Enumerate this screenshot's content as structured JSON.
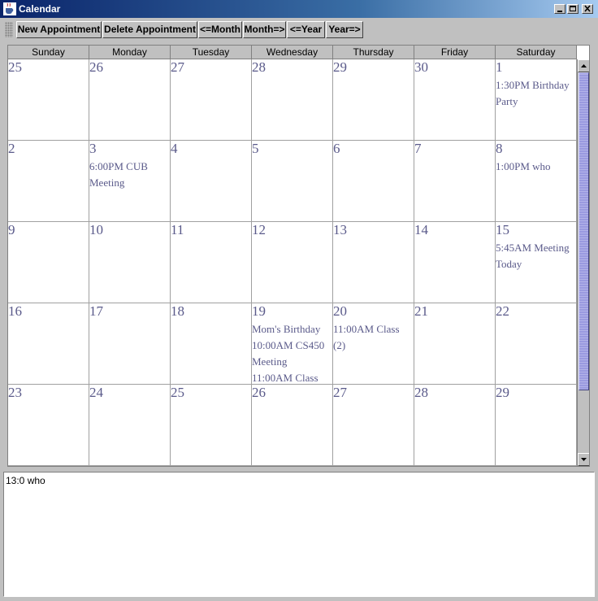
{
  "window": {
    "title": "Calendar",
    "icon": "java-coffee-icon"
  },
  "toolbar": {
    "new": "New Appointment",
    "delete": "Delete Appointment",
    "prev_month": "<=Month",
    "next_month": "Month=>",
    "prev_year": "<=Year",
    "next_year": "Year=>"
  },
  "calendar": {
    "days": [
      "Sunday",
      "Monday",
      "Tuesday",
      "Wednesday",
      "Thursday",
      "Friday",
      "Saturday"
    ],
    "weeks": [
      [
        {
          "n": "25",
          "a": []
        },
        {
          "n": "26",
          "a": []
        },
        {
          "n": "27",
          "a": []
        },
        {
          "n": "28",
          "a": []
        },
        {
          "n": "29",
          "a": []
        },
        {
          "n": "30",
          "a": []
        },
        {
          "n": "1",
          "a": [
            "1:30PM Birthday Party"
          ]
        }
      ],
      [
        {
          "n": "2",
          "a": []
        },
        {
          "n": "3",
          "a": [
            "6:00PM CUB Meeting"
          ]
        },
        {
          "n": "4",
          "a": []
        },
        {
          "n": "5",
          "a": []
        },
        {
          "n": "6",
          "a": []
        },
        {
          "n": "7",
          "a": []
        },
        {
          "n": "8",
          "a": [
            "1:00PM who"
          ]
        }
      ],
      [
        {
          "n": "9",
          "a": []
        },
        {
          "n": "10",
          "a": []
        },
        {
          "n": "11",
          "a": []
        },
        {
          "n": "12",
          "a": []
        },
        {
          "n": "13",
          "a": []
        },
        {
          "n": "14",
          "a": []
        },
        {
          "n": "15",
          "a": [
            "5:45AM Meeting Today"
          ]
        }
      ],
      [
        {
          "n": "16",
          "a": []
        },
        {
          "n": "17",
          "a": []
        },
        {
          "n": "18",
          "a": []
        },
        {
          "n": "19",
          "a": [
            "Mom's Birthday",
            "10:00AM CS450 Meeting",
            "11:00AM Class"
          ]
        },
        {
          "n": "20",
          "a": [
            "11:00AM Class (2)"
          ]
        },
        {
          "n": "21",
          "a": []
        },
        {
          "n": "22",
          "a": []
        }
      ],
      [
        {
          "n": "23",
          "a": []
        },
        {
          "n": "24",
          "a": []
        },
        {
          "n": "25",
          "a": []
        },
        {
          "n": "26",
          "a": []
        },
        {
          "n": "27",
          "a": []
        },
        {
          "n": "28",
          "a": []
        },
        {
          "n": "29",
          "a": []
        }
      ]
    ]
  },
  "details": {
    "text": "13:0 who"
  },
  "colors": {
    "titlebar_start": "#0a246a",
    "titlebar_end": "#a6caf0",
    "scroll_thumb": "#9a9ae0",
    "date_text": "#5a5a8a"
  }
}
